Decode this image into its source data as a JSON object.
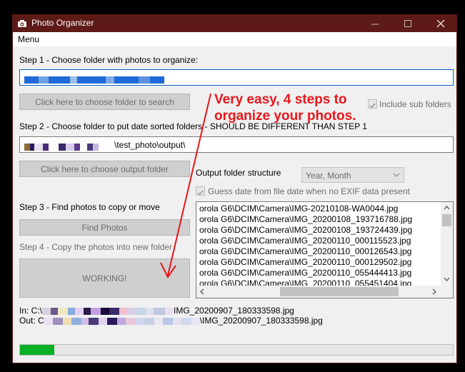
{
  "window": {
    "title": "Photo Organizer",
    "controls": {
      "minimize": "—",
      "maximize": "☐",
      "close": "✕"
    }
  },
  "menu": {
    "label": "Menu"
  },
  "step1": {
    "label": "Step 1 - Choose folder with photos to organize:",
    "button": "Click here to choose folder to search",
    "include_sub": "Include sub folders"
  },
  "step2": {
    "label": "Step 2 - Choose folder to put date sorted folders - SHOULD BE DIFFERENT THAN STEP 1",
    "path_suffix": "\\test_photo\\output\\",
    "button": "Click here to choose output folder",
    "structure_label": "Output folder structure",
    "structure_value": "Year, Month",
    "guess_date": "Guess date from file date when no EXIF data present"
  },
  "step3": {
    "label": "Step 3 - Find photos to copy or move",
    "button": "Find Photos"
  },
  "step4": {
    "label": "Step 4 - Copy the photos into new folder",
    "button": "WORKING!"
  },
  "files": [
    "orola G6\\DCIM\\Camera\\IMG-20210108-WA0044.jpg",
    "orola G6\\DCIM\\Camera\\IMG_20200108_193716788.jpg",
    "orola G6\\DCIM\\Camera\\IMG_20200108_193724439.jpg",
    "orola G6\\DCIM\\Camera\\IMG_20200110_000115523.jpg",
    "orola G6\\DCIM\\Camera\\IMG_20200110_000126543.jpg",
    "orola G6\\DCIM\\Camera\\IMG_20200110_000129502.jpg",
    "orola G6\\DCIM\\Camera\\IMG_20200110_055444413.jpg",
    "orola G6\\DCIM\\Camera\\IMG_20200110_055451404.jpg"
  ],
  "status": {
    "in_prefix": "In: C:\\",
    "in_file": "IMG_20200907_180333598.jpg",
    "out_prefix": "Out: C",
    "out_file": "\\IMG_20200907_180333598.jpg"
  },
  "progress": {
    "fraction": 0.08
  },
  "annotation": {
    "line1": "Very easy, 4 steps to",
    "line2": "organize your photos."
  },
  "colors": {
    "titlebar": "#5e1a17",
    "annotation": "#e8171b",
    "progress": "#06b025",
    "selection": "#1e6ad8"
  }
}
